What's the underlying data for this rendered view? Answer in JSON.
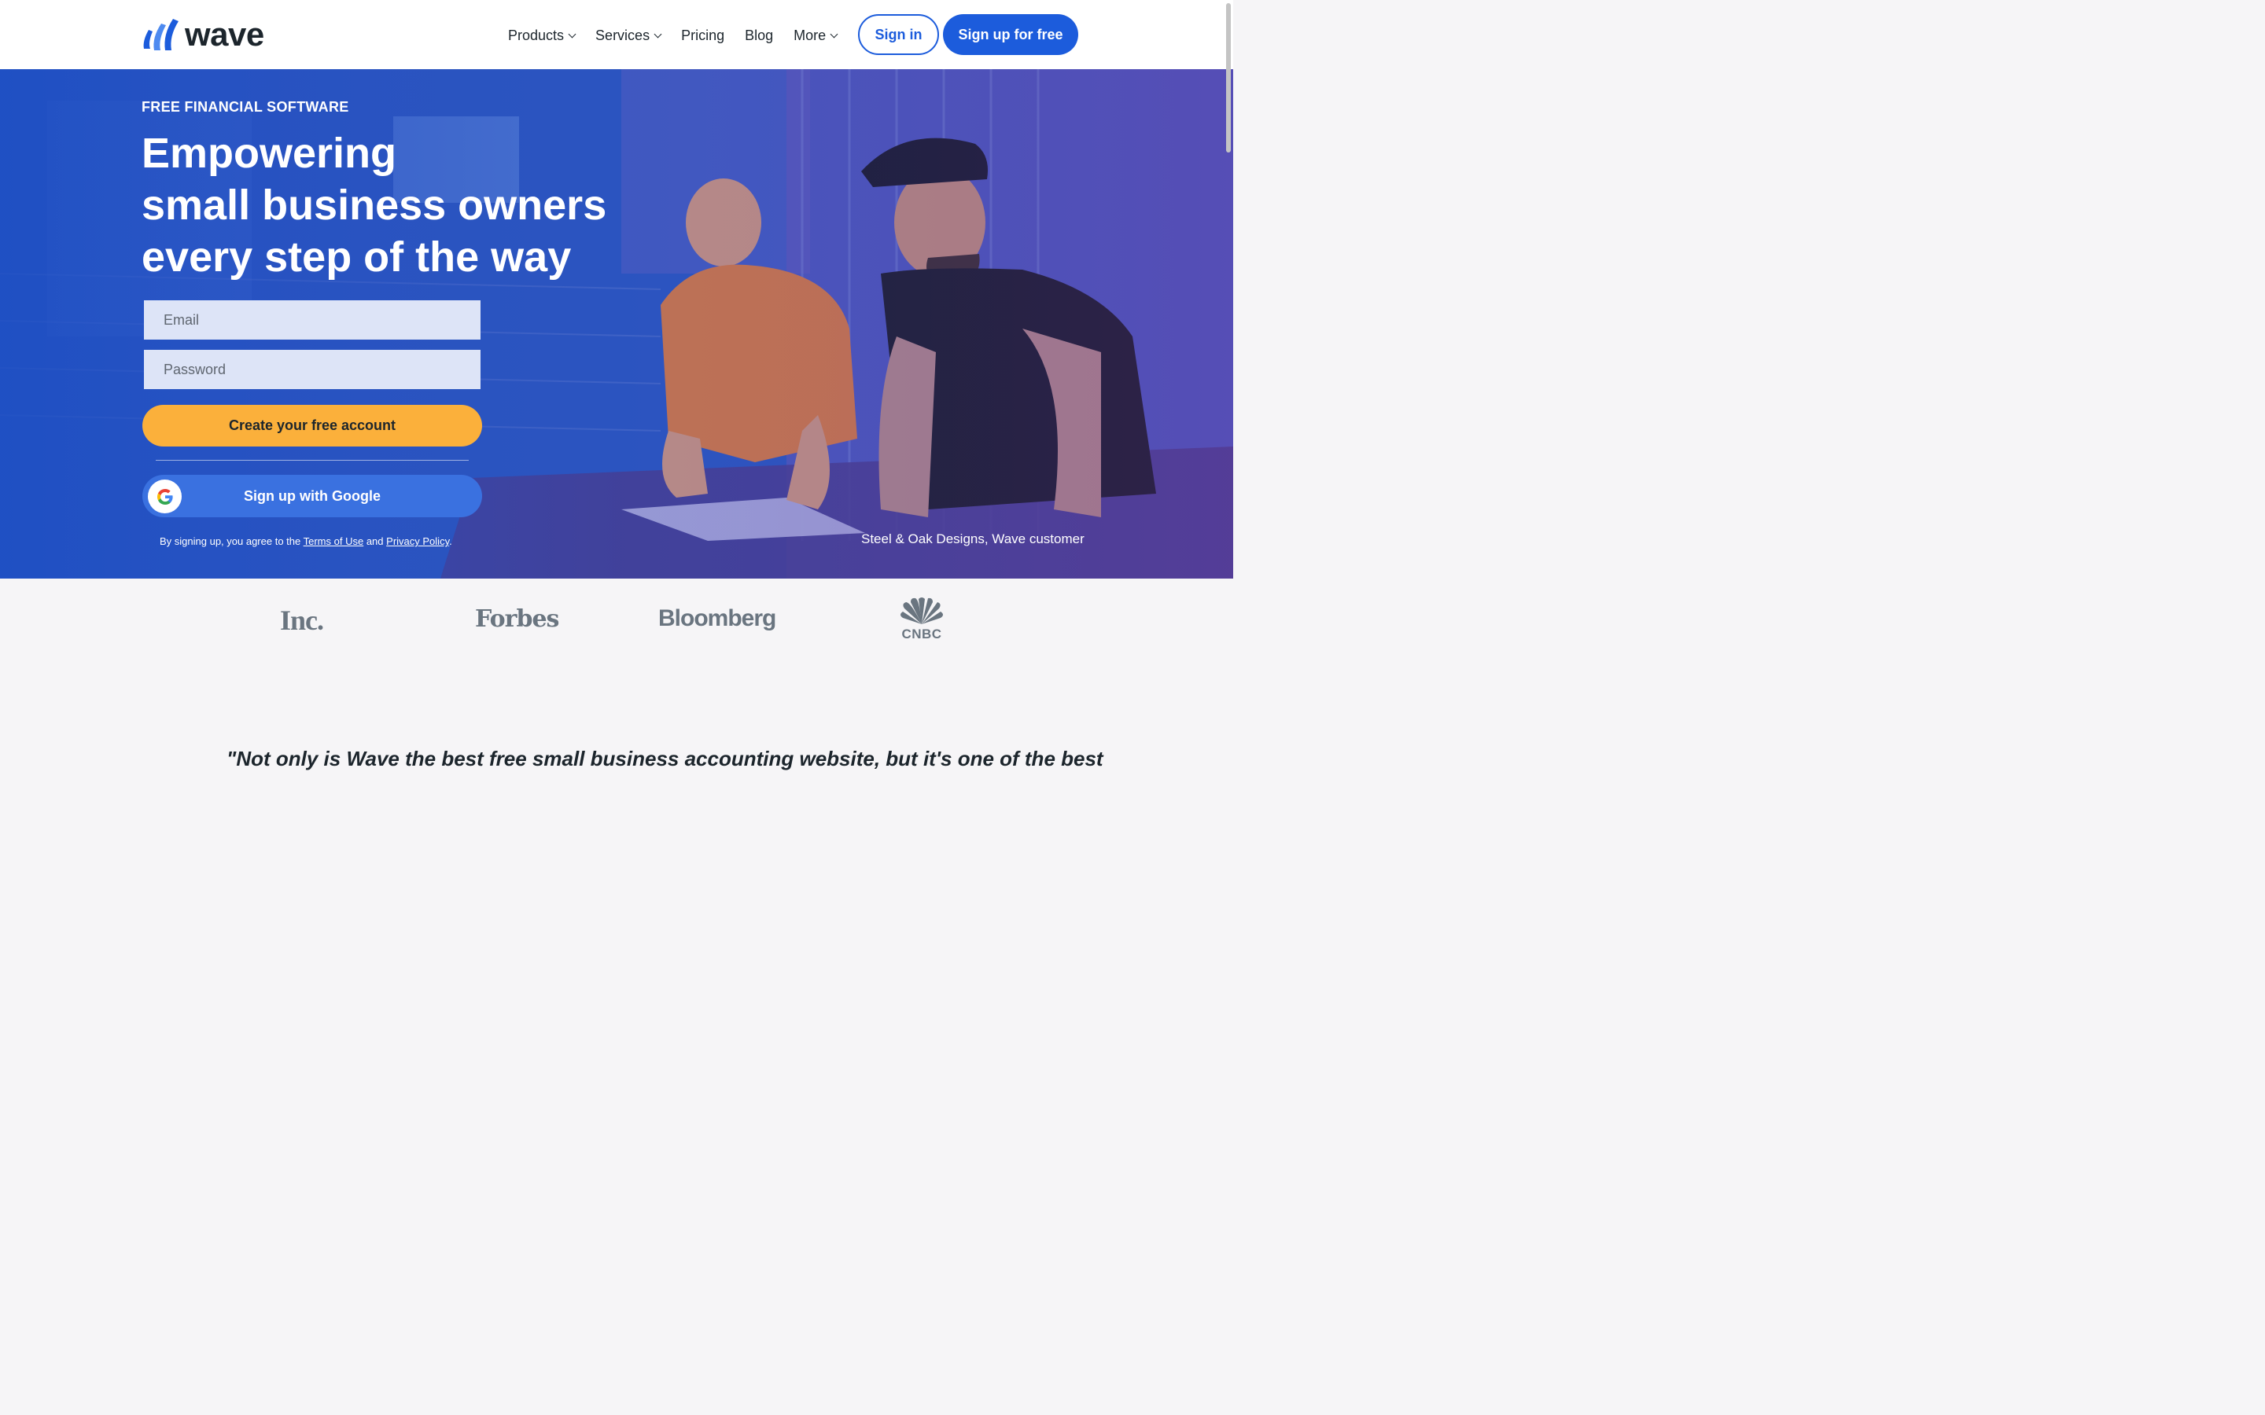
{
  "brand": {
    "name": "wave",
    "logo_icon": "wave-logo-icon"
  },
  "nav": {
    "items": [
      {
        "label": "Products",
        "has_dropdown": true
      },
      {
        "label": "Services",
        "has_dropdown": true
      },
      {
        "label": "Pricing",
        "has_dropdown": false
      },
      {
        "label": "Blog",
        "has_dropdown": false
      },
      {
        "label": "More",
        "has_dropdown": true
      }
    ],
    "signin_label": "Sign in",
    "signup_label": "Sign up for free"
  },
  "hero": {
    "eyebrow": "FREE FINANCIAL SOFTWARE",
    "headline": [
      "Empowering",
      "small business owners",
      "every step of the way"
    ],
    "email_placeholder": "Email",
    "password_placeholder": "Password",
    "create_label": "Create your free account",
    "google_label": "Sign up with Google",
    "legal": {
      "prefix": "By signing up, you agree to the",
      "terms": "Terms of Use",
      "and": "and",
      "privacy": "Privacy Policy",
      "suffix": "."
    },
    "caption": "Steel & Oak Designs, Wave customer"
  },
  "press": {
    "logos": [
      "Inc.",
      "Forbes",
      "Bloomberg",
      "CNBC"
    ]
  },
  "quote": "\"Not only is Wave the best free small business accounting website, but it's one of the best",
  "colors": {
    "primary": "#1c5cdc",
    "accent": "#fbb03b",
    "google_button": "#3a71e0",
    "text": "#1c252c",
    "press_gray": "#6a7580"
  }
}
